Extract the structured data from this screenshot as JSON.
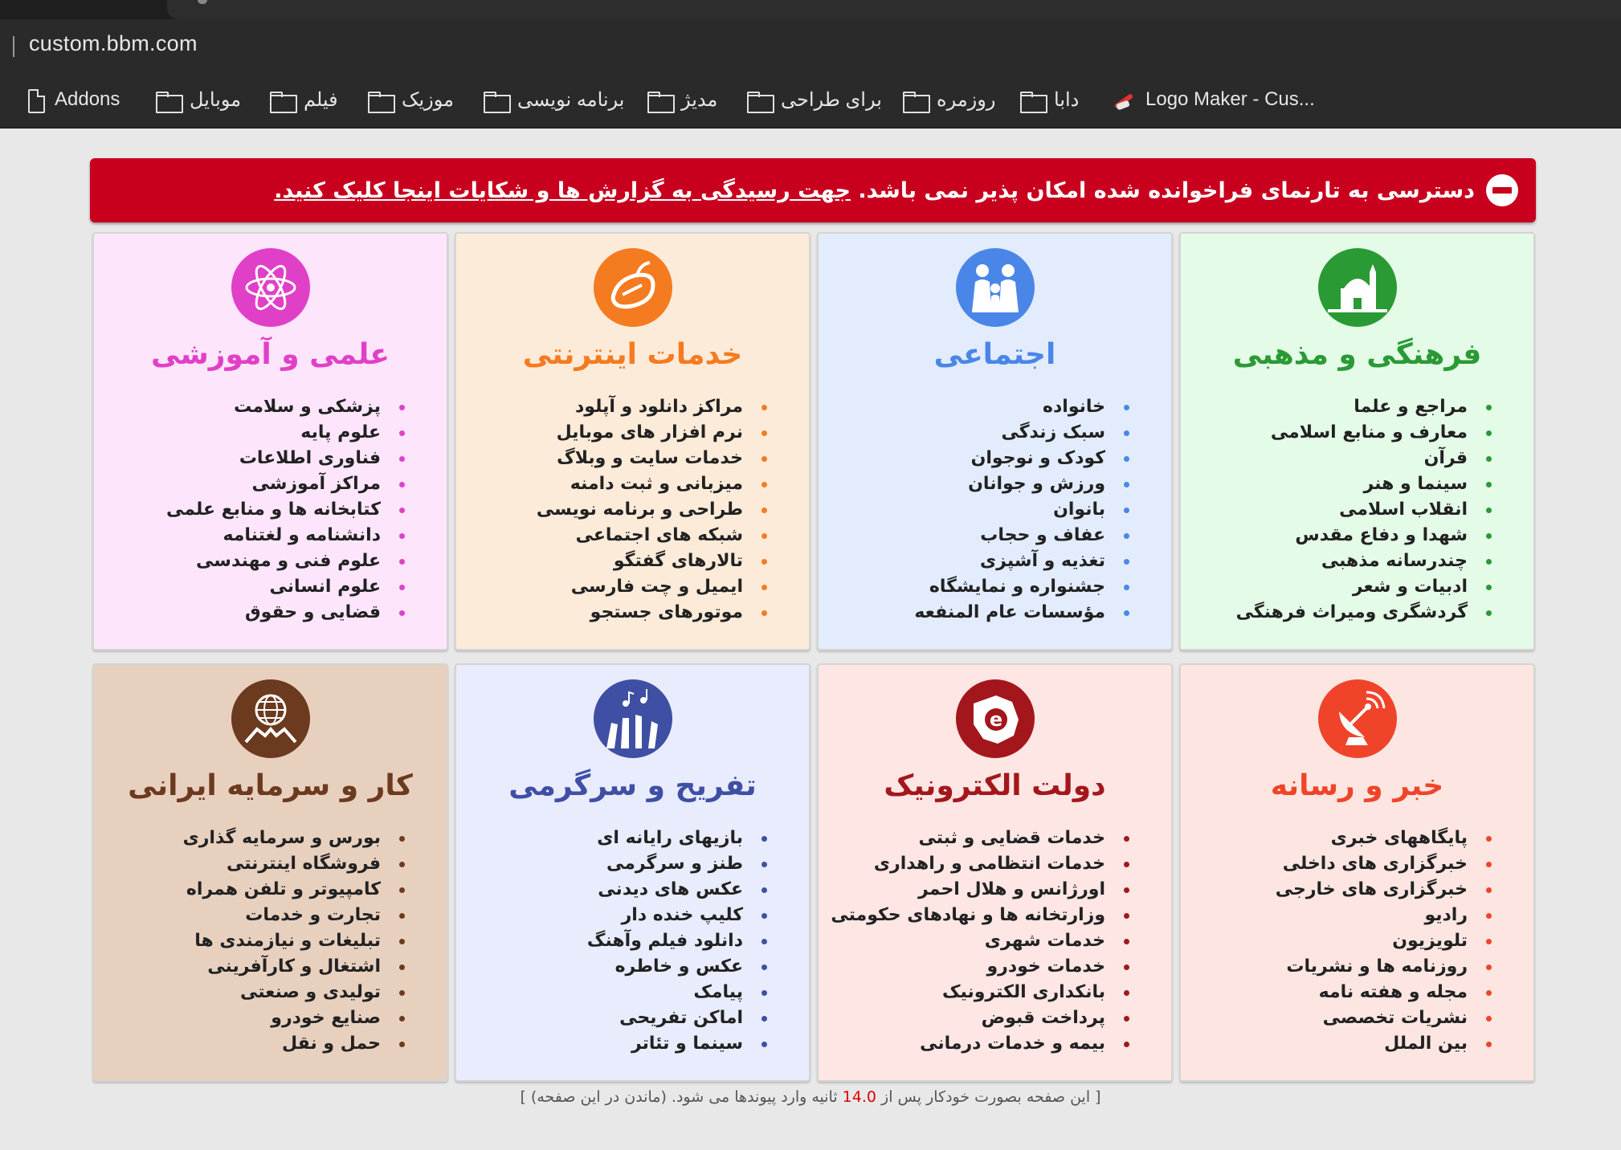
{
  "browser": {
    "url": "custom.bbm.com",
    "bookmarks": [
      {
        "label": "Addons",
        "icon": "page-icon"
      },
      {
        "label": "موبایل",
        "icon": "folder-icon"
      },
      {
        "label": "فیلم",
        "icon": "folder-icon"
      },
      {
        "label": "موزیک",
        "icon": "folder-icon"
      },
      {
        "label": "برنامه نویسی",
        "icon": "folder-icon"
      },
      {
        "label": "مدیژ",
        "icon": "folder-icon"
      },
      {
        "label": "برای طراحی",
        "icon": "folder-icon"
      },
      {
        "label": "روزمره",
        "icon": "folder-icon"
      },
      {
        "label": "دابا",
        "icon": "folder-icon"
      },
      {
        "label": "Logo Maker - Cus...",
        "icon": "logo-maker-icon"
      }
    ]
  },
  "alert": {
    "text": "دسترسی به تارنمای فراخوانده شده امکان پذیر نمی باشد.",
    "link": "جهت رسیدگی به گزارش ها و شکایات اینجا کلیک کنید.",
    "color": "#c8001e"
  },
  "categories": [
    {
      "title": "فرهنگی و مذهبی",
      "color": "#2a9a34",
      "bg": "#e4fbe8",
      "dot": "#2a9a34",
      "icon": "mosque-icon",
      "items": [
        "مراجع و علما",
        "معارف و منابع اسلامی",
        "قرآن",
        "سینما و هنر",
        "انقلاب اسلامی",
        "شهدا و دفاع مقدس",
        "چندرسانه مذهبی",
        "ادبیات و شعر",
        "گردشگری ومیراث فرهنگی"
      ]
    },
    {
      "title": "اجتماعی",
      "color": "#4a86e8",
      "bg": "#e2ecfc",
      "dot": "#4a86e8",
      "icon": "family-icon",
      "items": [
        "خانواده",
        "سبک زندگی",
        "کودک و نوجوان",
        "ورزش و جوانان",
        "بانوان",
        "عفاف و حجاب",
        "تغذیه و آشپزی",
        "جشنواره و نمایشگاه",
        "مؤسسات عام المنفعه"
      ]
    },
    {
      "title": "خدمات اینترنتی",
      "color": "#f47b20",
      "bg": "#fdebd9",
      "dot": "#f47b20",
      "icon": "mouse-icon",
      "items": [
        "مراکز دانلود و آپلود",
        "نرم افزار های موبایل",
        "خدمات سایت و وبلاگ",
        "میزبانی و ثبت دامنه",
        "طراحی و برنامه نویسی",
        "شبکه های اجتماعی",
        "تالارهای گفتگو",
        "ایمیل و چت فارسی",
        "موتورهای جستجو"
      ]
    },
    {
      "title": "علمی و آموزشی",
      "color": "#e040c8",
      "bg": "#fde6fb",
      "dot": "#e040c8",
      "icon": "atom-icon",
      "items": [
        "پزشکی و سلامت",
        "علوم پایه",
        "فناوری اطلاعات",
        "مراکز آموزشی",
        "کتابخانه ها و منابع علمی",
        "دانشنامه و لغتنامه",
        "علوم فنی و مهندسی",
        "علوم انسانی",
        "قضایی و حقوق"
      ]
    },
    {
      "title": "خبر و رسانه",
      "color": "#f0442a",
      "bg": "#fde6e2",
      "dot": "#f0442a",
      "icon": "satellite-icon",
      "items": [
        "پایگاههای خبری",
        "خبرگزاری های داخلی",
        "خبرگزاری های خارجی",
        "رادیو",
        "تلویزیون",
        "روزنامه ها و نشریات",
        "مجله و هفته نامه",
        "نشریات تخصصی",
        "بین الملل"
      ]
    },
    {
      "title": "دولت الکترونیک",
      "color": "#a3171c",
      "bg": "#fde6e4",
      "dot": "#a3171c",
      "icon": "e-government-icon",
      "items": [
        "خدمات قضایی و ثبتی",
        "خدمات انتظامی و راهداری",
        "اورژانس و هلال احمر",
        "وزارتخانه ها و نهادهای حکومتی",
        "خدمات شهری",
        "خدمات خودرو",
        "بانکداری الکترونیک",
        "پرداخت قبوض",
        "بیمه و خدمات درمانی"
      ]
    },
    {
      "title": "تفریح و سرگرمی",
      "color": "#3f4fa4",
      "bg": "#e8ecfd",
      "dot": "#3f4fa4",
      "icon": "party-icon",
      "items": [
        "بازیهای رایانه ای",
        "طنز و سرگرمی",
        "عکس های دیدنی",
        "کلیپ خنده دار",
        "دانلود فیلم وآهنگ",
        "عکس و خاطره",
        "پیامک",
        "اماکن تفریحی",
        "سینما و تئاتر"
      ]
    },
    {
      "title": "کار و سرمایه ایرانی",
      "color": "#6b3a1f",
      "bg": "#e8d0bf",
      "dot": "#6b3a1f",
      "icon": "business-globe-icon",
      "items": [
        "بورس و سرمایه گذاری",
        "فروشگاه اینترنتی",
        "کامپیوتر و تلفن همراه",
        "تجارت و خدمات",
        "تبلیغات و نیازمندی ها",
        "اشتغال و کارآفرینی",
        "تولیدی و صنعتی",
        "صنایع خودرو",
        "حمل و نقل"
      ]
    }
  ],
  "footer": {
    "before": "[ این صفحه بصورت خودکار پس از",
    "seconds": "14.0",
    "after": "ثانیه وارد پیوندها می شود. (ماندن در این صفحه) ]"
  }
}
